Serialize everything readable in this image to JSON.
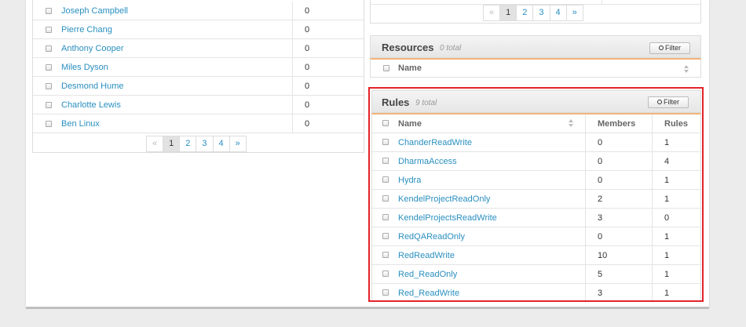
{
  "users": {
    "rows": [
      {
        "name": "Joseph Campbell",
        "value": "0"
      },
      {
        "name": "Pierre Chang",
        "value": "0"
      },
      {
        "name": "Anthony Cooper",
        "value": "0"
      },
      {
        "name": "Miles Dyson",
        "value": "0"
      },
      {
        "name": "Desmond Hume",
        "value": "0"
      },
      {
        "name": "Charlotte Lewis",
        "value": "0"
      },
      {
        "name": "Ben Linux",
        "value": "0"
      }
    ],
    "pager": {
      "prev": "«",
      "pages": [
        "1",
        "2",
        "3",
        "4"
      ],
      "next": "»",
      "current": "1"
    }
  },
  "top_right_pager": {
    "prev": "«",
    "pages": [
      "1",
      "2",
      "3",
      "4"
    ],
    "next": "»",
    "current": "1"
  },
  "resources": {
    "title": "Resources",
    "count": "0 total",
    "filter_label": "Filter",
    "columns": {
      "name": "Name"
    }
  },
  "rules": {
    "title": "Rules",
    "count": "9 total",
    "filter_label": "Filter",
    "columns": {
      "name": "Name",
      "members": "Members",
      "rules": "Rules"
    },
    "rows": [
      {
        "name": "ChanderReadWrite",
        "members": "0",
        "rules": "1"
      },
      {
        "name": "DharmaAccess",
        "members": "0",
        "rules": "4"
      },
      {
        "name": "Hydra",
        "members": "0",
        "rules": "1"
      },
      {
        "name": "KendelProjectReadOnly",
        "members": "2",
        "rules": "1"
      },
      {
        "name": "KendelProjectsReadWrite",
        "members": "3",
        "rules": "0"
      },
      {
        "name": "RedQAReadOnly",
        "members": "0",
        "rules": "1"
      },
      {
        "name": "RedReadWrite",
        "members": "10",
        "rules": "1"
      },
      {
        "name": "Red_ReadOnly",
        "members": "5",
        "rules": "1"
      },
      {
        "name": "Red_ReadWrite",
        "members": "3",
        "rules": "1"
      }
    ]
  },
  "colors": {
    "link": "#2a8fc0",
    "highlight": "#e3232b",
    "accent": "#f2b47a"
  }
}
